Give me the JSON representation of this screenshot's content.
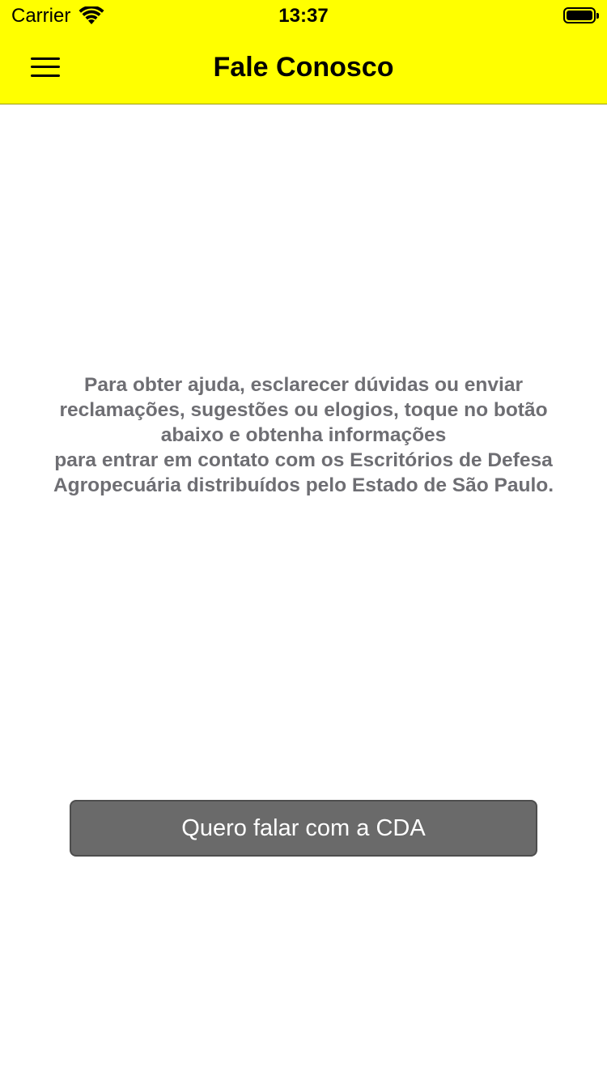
{
  "status_bar": {
    "carrier": "Carrier",
    "time": "13:37",
    "wifi_icon": "wifi-icon",
    "battery_icon": "battery-icon"
  },
  "nav_bar": {
    "title": "Fale Conosco",
    "menu_icon": "hamburger-menu-icon",
    "background_color": "#ffff00"
  },
  "main": {
    "info_text": "Para obter ajuda, esclarecer dúvidas ou enviar\nreclamações, sugestões ou elogios, toque no botão\nabaixo e obtenha informações\npara entrar em contato com os Escritórios de Defesa\nAgropecuária distribuídos pelo Estado de São Paulo.",
    "button_label": "Quero falar com a CDA",
    "button_color": "#6a6a6a"
  }
}
